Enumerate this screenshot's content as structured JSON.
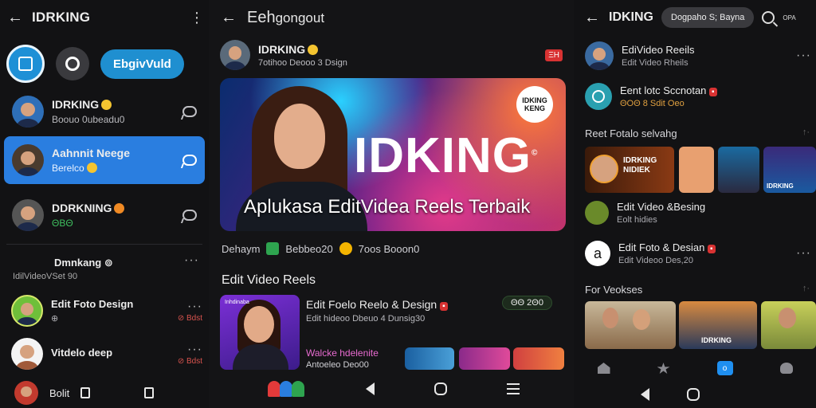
{
  "panel1": {
    "title": "IDRKING",
    "pill_button": "EbgivVuld",
    "chats": [
      {
        "name": "IDRKING",
        "sub": "Boouo 0ubeadu0"
      },
      {
        "name": "Aahnnit Neege",
        "sub": "Berelco"
      },
      {
        "name": "DDRKNING",
        "sub": "ΘΒΘ"
      }
    ],
    "section": {
      "title": "Dmnkang ⊚",
      "sub": "IdilVideoVSet 90"
    },
    "rows": [
      {
        "name": "Edit Foto Design",
        "sub": "⊕",
        "tag": "⊘ Bdst"
      },
      {
        "name": "Vitdelo deep",
        "sub": "",
        "tag": "⊘ Bdst"
      }
    ],
    "bottom_label": "Bolit"
  },
  "panel2": {
    "title": "Eeh",
    "title_suffix": "gongout",
    "author": {
      "name": "IDRKING",
      "sub": "7otihoo Deooo 3 Dsign",
      "badge": "ΞΗ"
    },
    "hero": {
      "brand": "IDKING",
      "tagline": "Aplukasa EditVidea Reels Terbaik",
      "logo_text": "IDKING KENG"
    },
    "stats": {
      "label": "Dehaym",
      "count1": "Bebbeo20",
      "count2": "7oos Booon0"
    },
    "section_title": "Edit Video Reels",
    "reel": {
      "thumb_tag": "Inhdinaba",
      "title": "Edit Foelo Reelo & Design",
      "sub": "Edit hideoo Dbeuo 4 Dunsig30",
      "counter": "ΘΘ 2Θ0",
      "watch": "Walcke hdelenite",
      "watch_sub": "Antoeleo Deo00"
    }
  },
  "panel3": {
    "title": "IDKING",
    "chip": "Dogpaho S; Bayna",
    "battery": "OPA",
    "rows": [
      {
        "name": "EdiVideo Reeils",
        "sub": "Edit Video Rheils"
      },
      {
        "name": "Eent lotc Sccnotan",
        "sub": "ΘΟΘ 8 Sdit Oeo"
      }
    ],
    "section1": "Reet Fotalo selvahg",
    "thumb_labels": [
      "IDRKING NIDIEK",
      "IDRKING"
    ],
    "rows2": [
      {
        "name": "Edit Video &Besing",
        "sub": "Eolt hidies"
      },
      {
        "name": "Edit Foto & Desian",
        "sub": "Edit Videoo Des,20"
      }
    ],
    "section2": "For Veokses",
    "thumb2_label": "IDRKING"
  },
  "colors": {
    "accent": "#2a7ee0",
    "pill": "#1f8fd0",
    "badge": "#d83232"
  }
}
